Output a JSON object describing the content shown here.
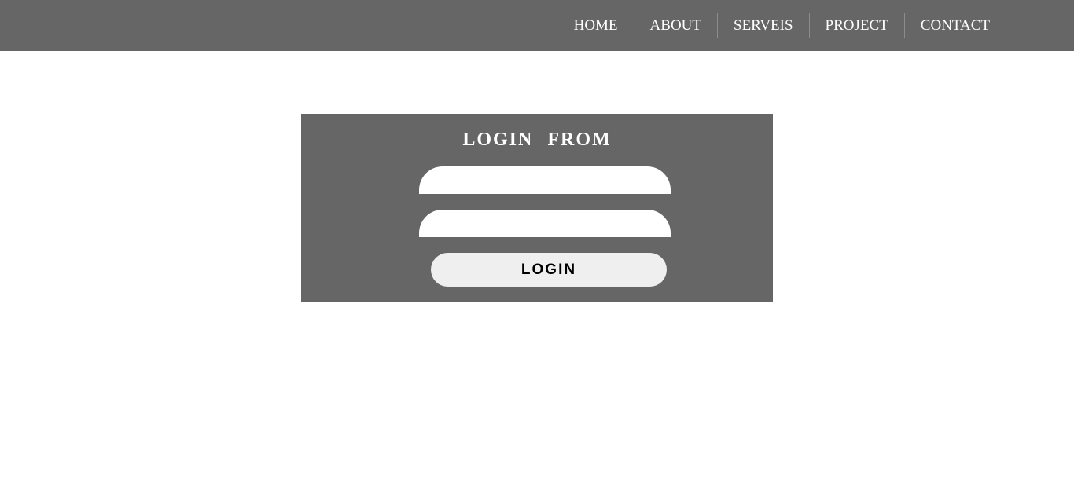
{
  "nav": {
    "items": [
      {
        "label": "HOME"
      },
      {
        "label": "ABOUT"
      },
      {
        "label": "SERVEIS"
      },
      {
        "label": "PROJECT"
      },
      {
        "label": "CONTACT"
      }
    ]
  },
  "login": {
    "title": "LOGIN FROM",
    "username_value": "",
    "password_value": "",
    "button_label": "LOGIN"
  },
  "colors": {
    "navbar_bg": "#666666",
    "panel_bg": "#666666",
    "button_bg": "#efefef",
    "page_bg": "#ffffff"
  }
}
